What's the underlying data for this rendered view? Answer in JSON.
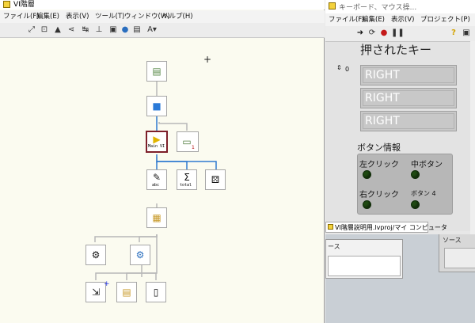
{
  "hierarchy_window": {
    "title": "VI階層",
    "menu": [
      "ファイル(F)",
      "編集(E)",
      "表示(V)",
      "ツール(T)",
      "ウィンドウ(W)",
      "ヘルプ(H)"
    ],
    "nodes": {
      "mainvi_label": "Main VI",
      "abc_label": "abc",
      "total_label": "total",
      "subvi_badge": "1"
    }
  },
  "front_panel_window": {
    "title": "キーボード、マウス操...",
    "menu": [
      "ファイル(F)",
      "編集(E)",
      "表示(V)",
      "プロジェクト(P)"
    ],
    "array_index": "0",
    "pressed_keys_label": "押されたキー",
    "pressed_keys": [
      "RIGHT",
      "RIGHT",
      "RIGHT"
    ],
    "button_info_label": "ボタン情報",
    "buttons": [
      "左クリック",
      "中ボタン",
      "右クリック",
      "ボタン 4"
    ],
    "project_tab": "VI階層説明用.lvproj/マイ コンピュータ"
  },
  "block_diagram": {
    "source_label_left": "ース",
    "source_label_right": "ソース"
  },
  "colors": {
    "selected_node_border": "#7d1f2a",
    "wire_blue": "#2f7ad0",
    "led_off": "#1f4a12"
  }
}
